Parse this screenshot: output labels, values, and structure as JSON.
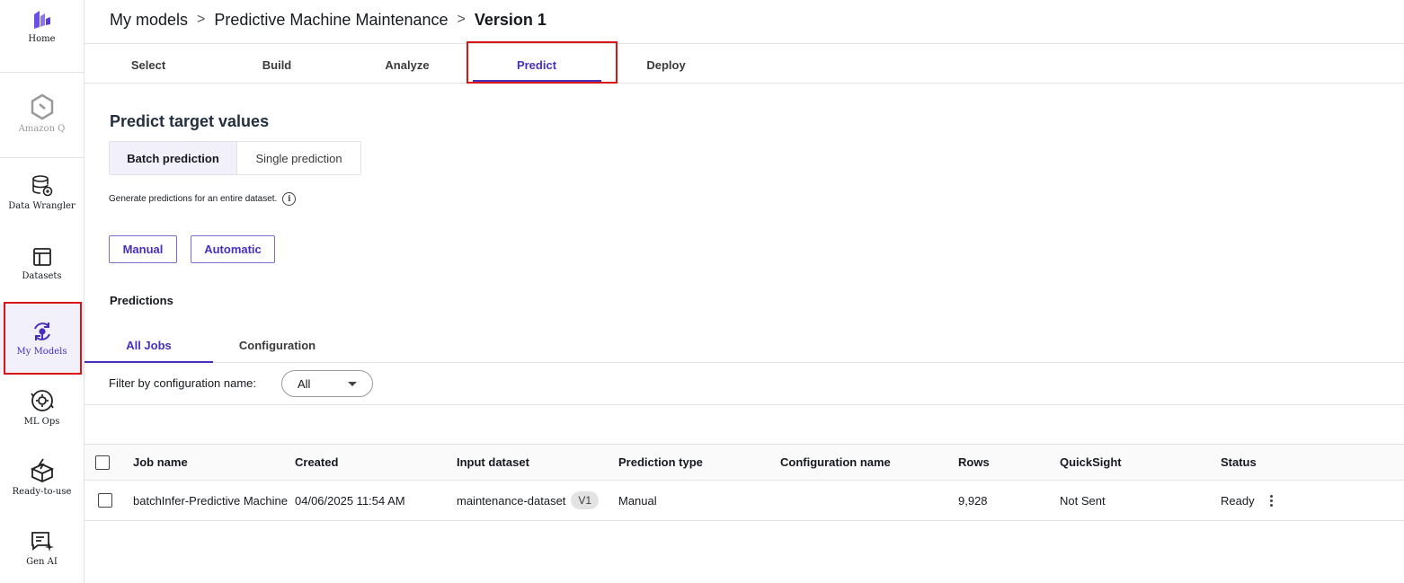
{
  "sidebar": {
    "items": [
      {
        "label": "Home",
        "icon": "home-logo-icon"
      },
      {
        "label": "Amazon Q",
        "icon": "amazon-q-icon"
      },
      {
        "label": "Data Wrangler",
        "icon": "database-icon"
      },
      {
        "label": "Datasets",
        "icon": "table-icon"
      },
      {
        "label": "My Models",
        "icon": "model-cycle-icon"
      },
      {
        "label": "ML Ops",
        "icon": "ml-ops-gear-icon"
      },
      {
        "label": "Ready-to-use",
        "icon": "box-lightning-icon"
      },
      {
        "label": "Gen AI",
        "icon": "chat-sparkle-icon"
      }
    ]
  },
  "breadcrumb": {
    "items": [
      "My models",
      "Predictive Machine Maintenance"
    ],
    "current": "Version 1"
  },
  "top_tabs": [
    "Select",
    "Build",
    "Analyze",
    "Predict",
    "Deploy"
  ],
  "active_top_tab": "Predict",
  "predict": {
    "title": "Predict target values",
    "segments": [
      "Batch prediction",
      "Single prediction"
    ],
    "active_segment": "Batch prediction",
    "description": "Generate predictions for an entire dataset.",
    "manual_label": "Manual",
    "automatic_label": "Automatic"
  },
  "predictions": {
    "heading": "Predictions",
    "tabs": [
      "All Jobs",
      "Configuration"
    ],
    "active_tab": "All Jobs",
    "filter_label": "Filter by configuration name:",
    "filter_value": "All"
  },
  "table": {
    "columns": [
      "Job name",
      "Created",
      "Input dataset",
      "Prediction type",
      "Configuration name",
      "Rows",
      "QuickSight",
      "Status"
    ],
    "rows": [
      {
        "job_name": "batchInfer-Predictive Machine",
        "created": "04/06/2025 11:54 AM",
        "input_dataset": "maintenance-dataset",
        "dataset_version": "V1",
        "prediction_type": "Manual",
        "configuration_name": "",
        "rows": "9,928",
        "quicksight": "Not Sent",
        "status": "Ready"
      }
    ]
  },
  "colors": {
    "accent": "#4a2fbd",
    "highlight": "#d91515",
    "active_bg": "#f2f0fb"
  }
}
